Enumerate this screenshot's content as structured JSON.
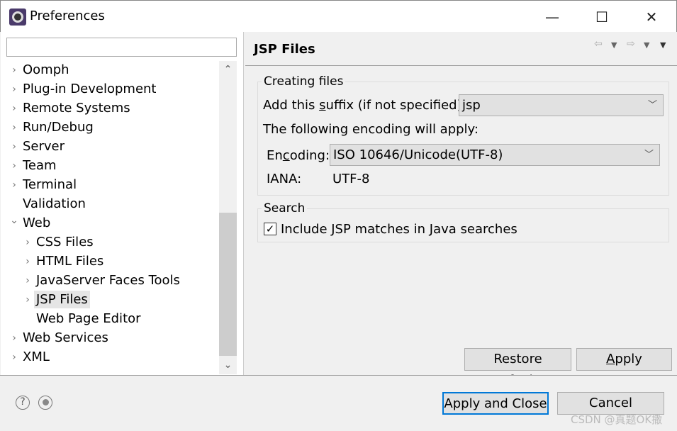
{
  "window": {
    "title": "Preferences",
    "minimize": "—",
    "maximize": "☐",
    "close": "✕"
  },
  "sidebar": {
    "filter_value": "",
    "items": [
      {
        "label": "Oomph",
        "level": 0,
        "expander": "collapsed"
      },
      {
        "label": "Plug-in Development",
        "level": 0,
        "expander": "collapsed"
      },
      {
        "label": "Remote Systems",
        "level": 0,
        "expander": "collapsed"
      },
      {
        "label": "Run/Debug",
        "level": 0,
        "expander": "collapsed"
      },
      {
        "label": "Server",
        "level": 0,
        "expander": "collapsed"
      },
      {
        "label": "Team",
        "level": 0,
        "expander": "collapsed"
      },
      {
        "label": "Terminal",
        "level": 0,
        "expander": "collapsed"
      },
      {
        "label": "Validation",
        "level": 0,
        "expander": "none"
      },
      {
        "label": "Web",
        "level": 0,
        "expander": "expanded"
      },
      {
        "label": "CSS Files",
        "level": 1,
        "expander": "collapsed"
      },
      {
        "label": "HTML Files",
        "level": 1,
        "expander": "collapsed"
      },
      {
        "label": "JavaServer Faces Tools",
        "level": 1,
        "expander": "collapsed"
      },
      {
        "label": "JSP Files",
        "level": 1,
        "expander": "collapsed",
        "selected": true
      },
      {
        "label": "Web Page Editor",
        "level": 1,
        "expander": "none"
      },
      {
        "label": "Web Services",
        "level": 0,
        "expander": "collapsed"
      },
      {
        "label": "XML",
        "level": 0,
        "expander": "collapsed"
      }
    ]
  },
  "page": {
    "title": "JSP Files",
    "creating": {
      "legend": "Creating files",
      "suffix_pre": "Add this ",
      "suffix_mn": "s",
      "suffix_post": "uffix (if not specified):",
      "suffix_value": "jsp",
      "encoding_note": "The following encoding will apply:",
      "enc_pre": "En",
      "enc_mn": "c",
      "enc_post": "oding:",
      "encoding_value": "ISO 10646/Unicode(UTF-8)",
      "iana_label": "IANA:",
      "iana_value": "UTF-8"
    },
    "search": {
      "legend": "Search",
      "include_label": "Include JSP matches in Java searches",
      "include_checked": true
    },
    "restore_pre": "Restore ",
    "restore_mn": "D",
    "restore_post": "efaults",
    "apply_mn": "A",
    "apply_post": "pply"
  },
  "footer": {
    "apply_close": "Apply and Close",
    "cancel": "Cancel",
    "help_icon": "?",
    "watermark": "CSDN @真题OK撒"
  }
}
